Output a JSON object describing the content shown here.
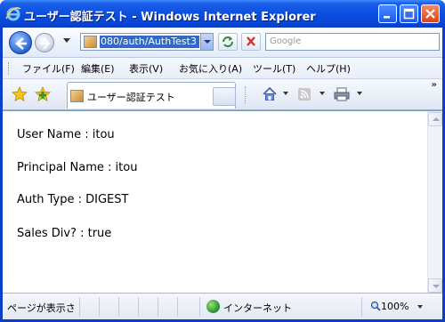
{
  "window": {
    "title": "ユーザー認証テスト - Windows Internet Explorer"
  },
  "address": {
    "url_display": "080/auth/AuthTest3",
    "search_placeholder": "Google"
  },
  "menu": {
    "items": [
      {
        "label": "ファイル(F)"
      },
      {
        "label": "編集(E)"
      },
      {
        "label": "表示(V)"
      },
      {
        "label": "お気に入り(A)"
      },
      {
        "label": "ツール(T)"
      },
      {
        "label": "ヘルプ(H)"
      }
    ]
  },
  "tab": {
    "label": "ユーザー認証テスト"
  },
  "toolbar": {
    "overflow": "»"
  },
  "content": {
    "lines": [
      "User Name : itou",
      "Principal Name : itou",
      "Auth Type : DIGEST",
      "Sales Div? : true"
    ]
  },
  "status": {
    "text": "ページが表示さ",
    "zone": "インターネット",
    "zoom": "100%"
  },
  "colors": {
    "titlebar": "#0a4fe0",
    "selection": "#316ac5"
  }
}
